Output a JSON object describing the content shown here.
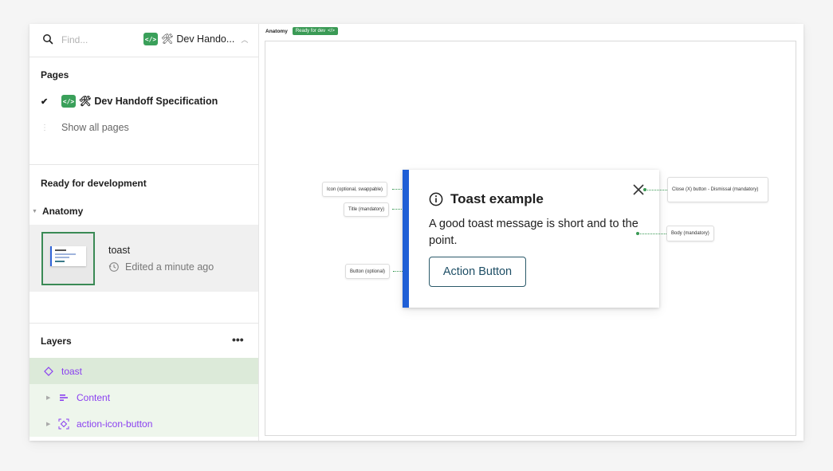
{
  "sidebar": {
    "search": {
      "placeholder": "Find..."
    },
    "file": {
      "badge": "</>",
      "name": "🛠 Dev Hando...",
      "tools": "🛠"
    },
    "pages": {
      "title": "Pages",
      "items": [
        {
          "badge": "</>",
          "label": "🛠 Dev Handoff Specification",
          "selected": true
        }
      ],
      "show_all": "Show all pages"
    },
    "ready": {
      "title": "Ready for development",
      "section": "Anatomy",
      "card": {
        "name": "toast",
        "edited": "Edited a minute ago"
      }
    },
    "layers": {
      "title": "Layers",
      "more": "•••",
      "items": [
        {
          "label": "toast",
          "icon": "component-instance-icon"
        },
        {
          "label": "Content",
          "icon": "auto-layout-icon"
        },
        {
          "label": "action-icon-button",
          "icon": "instance-frame-icon"
        }
      ]
    }
  },
  "canvas": {
    "section_label": "Anatomy",
    "status_tag": "Ready for dev",
    "status_tag_icon": "</>",
    "toast": {
      "title": "Toast example",
      "body": "A good toast message is short and to the point.",
      "action": "Action Button"
    },
    "annotations": {
      "icon": "Icon (optional, swappable)",
      "title": "Title (mandatory)",
      "button": "Button (optional)",
      "close": "Close (X) button - Dismissal (mandatory)",
      "body": "Body (mandatory)"
    }
  },
  "colors": {
    "accent_green": "#3a9a55",
    "toast_border": "#1f5fd6",
    "layer_purple": "#8a3ff0",
    "selected_layer_bg": "#dcead9"
  }
}
